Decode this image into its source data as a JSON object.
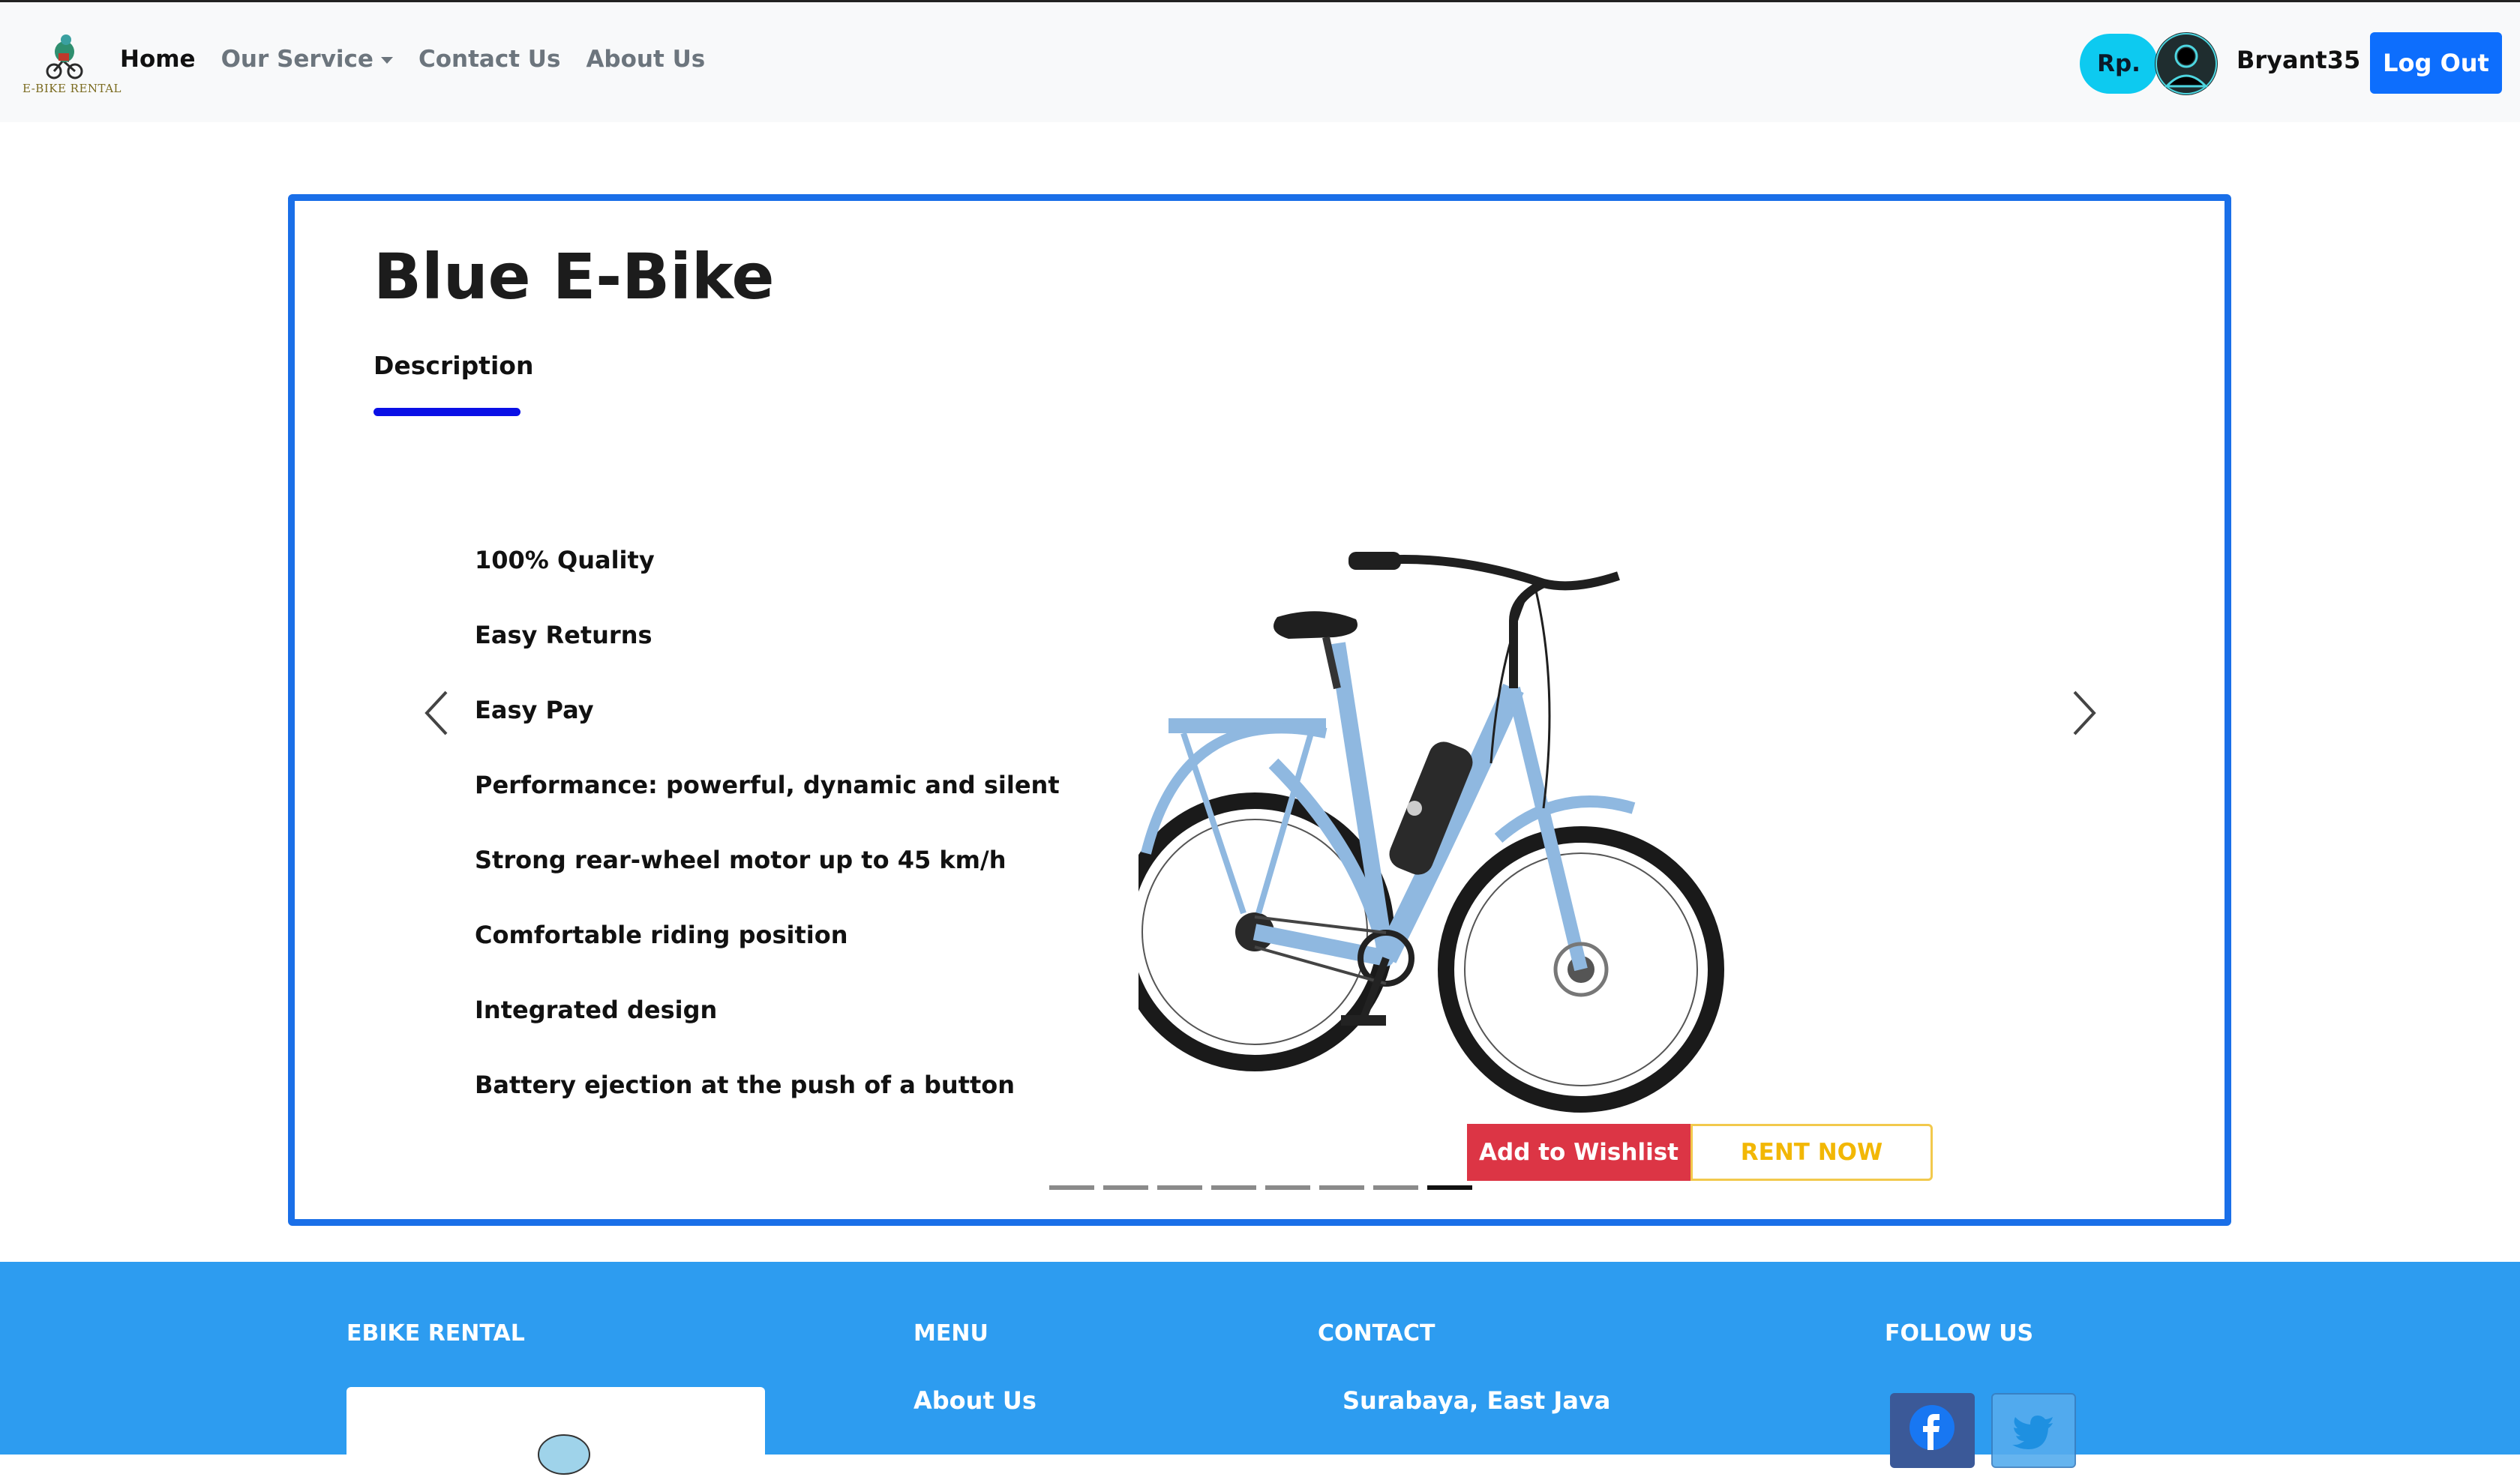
{
  "navbar": {
    "logo_text": "E-BIKE RENTAL",
    "links": [
      {
        "label": "Home",
        "active": true
      },
      {
        "label": "Our Service",
        "dropdown": true
      },
      {
        "label": "Contact Us"
      },
      {
        "label": "About Us"
      }
    ],
    "currency_badge": "Rp.",
    "username": "Bryant35",
    "logout_label": "Log Out"
  },
  "product": {
    "title": "Blue E-Bike",
    "tab_label": "Description",
    "features": [
      "100% Quality",
      "Easy Returns",
      "Easy Pay",
      "Performance: powerful, dynamic and silent",
      "Strong rear-wheel motor up to 45 km/h",
      "Comfortable riding position",
      "Integrated design",
      "Battery ejection at the push of a button"
    ],
    "wishlist_label": "Add to Wishlist",
    "rent_label": "RENT NOW",
    "carousel": {
      "slide_count": 8,
      "active_index": 7
    }
  },
  "footer": {
    "col1_heading": "EBIKE RENTAL",
    "col2_heading": "MENU",
    "col2_link": "About Us",
    "col3_heading": "CONTACT",
    "col3_text": "Surabaya, East Java",
    "col4_heading": "FOLLOW US"
  },
  "colors": {
    "primary": "#0d6efd",
    "card_border": "#1a6fe8",
    "footer_bg": "#2d9cf0",
    "badge": "#0dcaf0",
    "danger": "#dc3545",
    "warning": "#f2b705",
    "bike": "#8fb8e0"
  },
  "icons": {
    "prev": "chevron-left-icon",
    "next": "chevron-right-icon",
    "facebook": "facebook-icon",
    "twitter": "twitter-icon",
    "avatar": "user-avatar-icon"
  }
}
